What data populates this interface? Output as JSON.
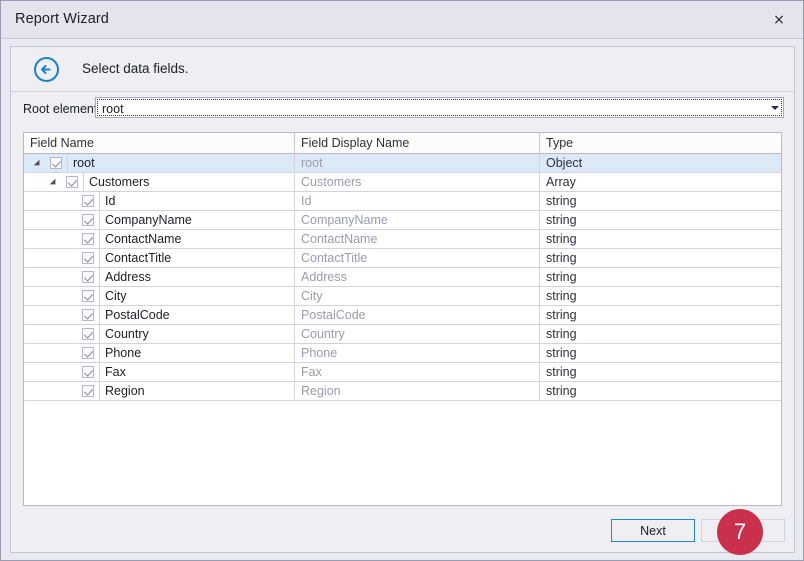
{
  "window": {
    "title": "Report Wizard",
    "close_icon": "close-icon",
    "close_label": "×"
  },
  "step": {
    "back_icon": "back-arrow-circle-icon",
    "title": "Select data fields."
  },
  "root_element": {
    "label": "Root element:",
    "value": "root",
    "placeholder": "root",
    "caret_icon": "chevron-down-icon"
  },
  "grid": {
    "columns": [
      "Field Name",
      "Field Display Name",
      "Type"
    ],
    "rows": [
      {
        "name": "root",
        "display": "root",
        "type": "Object",
        "depth": 0,
        "checked": true,
        "expandable": true,
        "selected": true
      },
      {
        "name": "Customers",
        "display": "Customers",
        "type": "Array",
        "depth": 1,
        "checked": true,
        "expandable": true,
        "selected": false
      },
      {
        "name": "Id",
        "display": "Id",
        "type": "string",
        "depth": 2,
        "checked": true,
        "expandable": false,
        "selected": false
      },
      {
        "name": "CompanyName",
        "display": "CompanyName",
        "type": "string",
        "depth": 2,
        "checked": true,
        "expandable": false,
        "selected": false
      },
      {
        "name": "ContactName",
        "display": "ContactName",
        "type": "string",
        "depth": 2,
        "checked": true,
        "expandable": false,
        "selected": false
      },
      {
        "name": "ContactTitle",
        "display": "ContactTitle",
        "type": "string",
        "depth": 2,
        "checked": true,
        "expandable": false,
        "selected": false
      },
      {
        "name": "Address",
        "display": "Address",
        "type": "string",
        "depth": 2,
        "checked": true,
        "expandable": false,
        "selected": false
      },
      {
        "name": "City",
        "display": "City",
        "type": "string",
        "depth": 2,
        "checked": true,
        "expandable": false,
        "selected": false
      },
      {
        "name": "PostalCode",
        "display": "PostalCode",
        "type": "string",
        "depth": 2,
        "checked": true,
        "expandable": false,
        "selected": false
      },
      {
        "name": "Country",
        "display": "Country",
        "type": "string",
        "depth": 2,
        "checked": true,
        "expandable": false,
        "selected": false
      },
      {
        "name": "Phone",
        "display": "Phone",
        "type": "string",
        "depth": 2,
        "checked": true,
        "expandable": false,
        "selected": false
      },
      {
        "name": "Fax",
        "display": "Fax",
        "type": "string",
        "depth": 2,
        "checked": true,
        "expandable": false,
        "selected": false
      },
      {
        "name": "Region",
        "display": "Region",
        "type": "string",
        "depth": 2,
        "checked": true,
        "expandable": false,
        "selected": false
      }
    ]
  },
  "footer": {
    "next_label": "Next",
    "finish_label": "",
    "badge_number": "7"
  },
  "colors": {
    "accent": "#2288cc",
    "badge": "#c9304d",
    "selection": "#dce9f7",
    "window_bg": "#eeeef3"
  }
}
